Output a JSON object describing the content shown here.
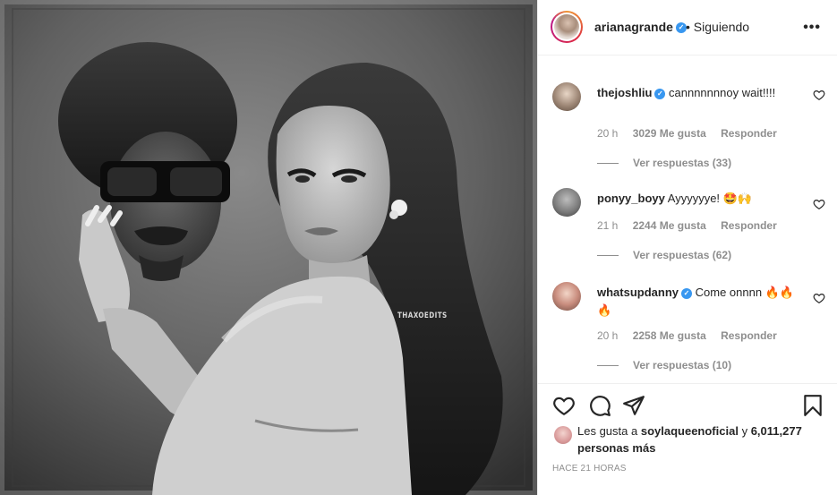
{
  "post": {
    "watermark": "THAXOEDITS"
  },
  "header": {
    "username": "arianagrande",
    "verified_glyph": "✓",
    "separator": "•",
    "follow_label": "Siguiendo",
    "more_label": "•••"
  },
  "comments": [
    {
      "username": "thejoshliu",
      "verified": true,
      "text": "cannnnnnnoy wait!!!!",
      "time": "20 h",
      "likes": "3029 Me gusta",
      "reply_label": "Responder",
      "view_replies": "Ver respuestas (33)",
      "avatar_icon": "user-avatar"
    },
    {
      "username": "ponyy_boyy",
      "verified": false,
      "text": "Ayyyyyye! 🤩🙌",
      "time": "21 h",
      "likes": "2244 Me gusta",
      "reply_label": "Responder",
      "view_replies": "Ver respuestas (62)",
      "avatar_icon": "user-avatar"
    },
    {
      "username": "whatsupdanny",
      "verified": true,
      "text": "Come onnnn 🔥🔥🔥",
      "time": "20 h",
      "likes": "2258 Me gusta",
      "reply_label": "Responder",
      "view_replies": "Ver respuestas (10)",
      "avatar_icon": "user-avatar"
    }
  ],
  "likes": {
    "prefix": "Les gusta a",
    "user": "soylaqueenoficial",
    "connector": "y",
    "count": "6,011,277 personas más"
  },
  "timestamp": "HACE 21 HORAS",
  "colors": {
    "verified": "#3897f0",
    "muted": "#8e8e8e",
    "text": "#262626",
    "border": "#efefef"
  }
}
